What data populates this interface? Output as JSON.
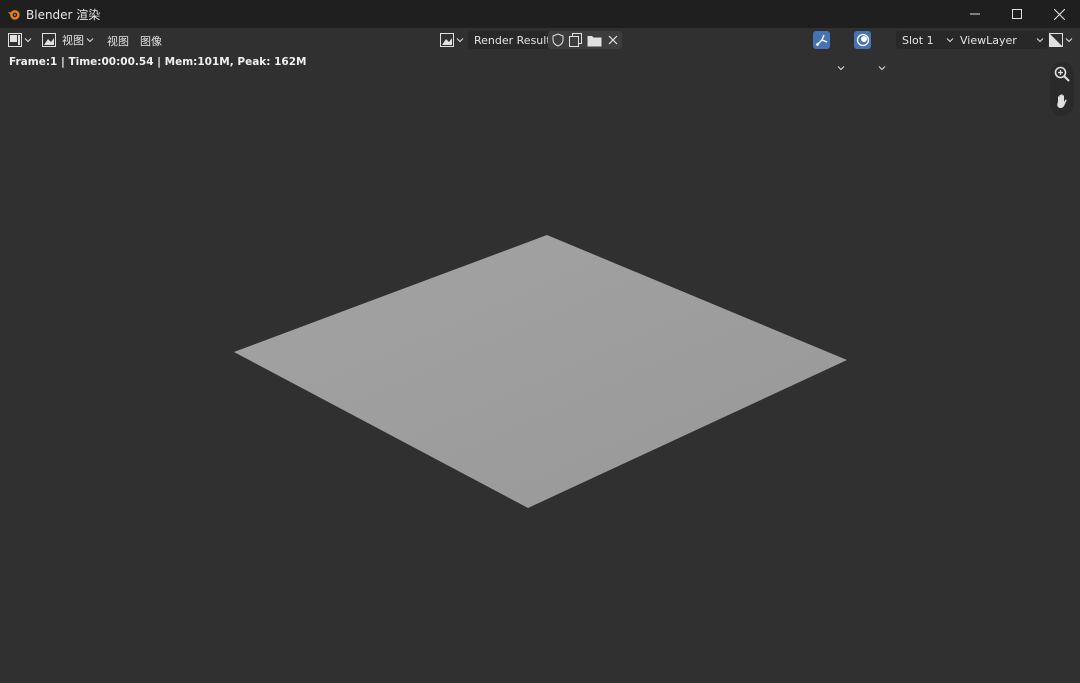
{
  "window": {
    "title": "Blender 渲染"
  },
  "header": {
    "menu_view": "视图",
    "menu_view2": "视图",
    "menu_image": "图像",
    "image_name": "Render Result",
    "slot": "Slot 1",
    "view_layer": "ViewLayer"
  },
  "info": {
    "text": "Frame:1 | Time:00:00.54 | Mem:101M, Peak: 162M"
  },
  "colors": {
    "accent": "#4772b3",
    "plane": "#9e9e9e",
    "background": "#303030"
  },
  "icons": [
    "blender-logo-icon",
    "minimize-icon",
    "maximize-icon",
    "close-icon",
    "editor-type-icon",
    "view-mode-icon",
    "image-browse-icon",
    "fake-user-shield-icon",
    "new-image-icon",
    "open-image-icon",
    "unlink-x-icon",
    "sample-tool-icon",
    "display-channels-icon",
    "color-display-icon",
    "zoom-icon",
    "pan-hand-icon"
  ]
}
